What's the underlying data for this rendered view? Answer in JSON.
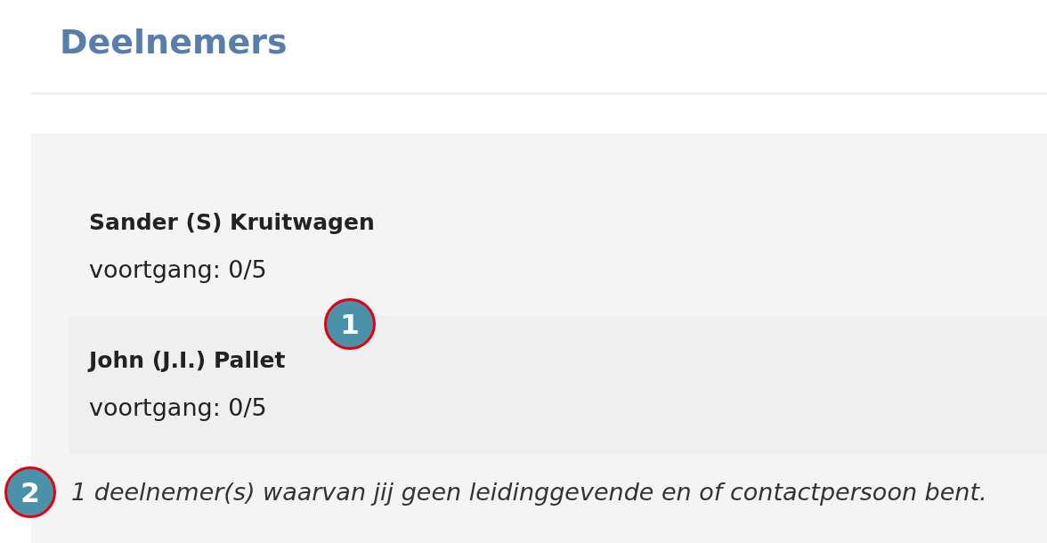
{
  "page": {
    "title": "Deelnemers"
  },
  "participants": [
    {
      "name": "Sander (S) Kruitwagen",
      "progress": "voortgang: 0/5"
    },
    {
      "name": "John (J.I.) Pallet",
      "progress": "voortgang: 0/5",
      "marker": "1"
    }
  ],
  "note": {
    "text": "1 deelnemer(s) waarvan jij geen leidinggevende en of contactpersoon bent.",
    "marker": "2"
  }
}
